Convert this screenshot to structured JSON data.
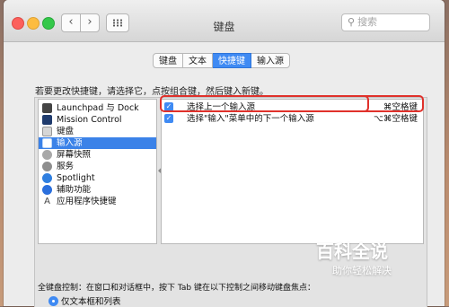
{
  "window": {
    "title": "键盘",
    "search_placeholder": "搜索",
    "nav_back": "‹",
    "nav_forward": "›"
  },
  "tabs": [
    {
      "label": "键盘",
      "active": false
    },
    {
      "label": "文本",
      "active": false
    },
    {
      "label": "快捷键",
      "active": true
    },
    {
      "label": "输入源",
      "active": false
    }
  ],
  "instruction": "若要更改快捷键，请选择它，点按组合键，然后键入新键。",
  "categories": [
    {
      "label": "Launchpad 与 Dock",
      "icon": "launchpad-icon",
      "selected": false
    },
    {
      "label": "Mission Control",
      "icon": "mission-control-icon",
      "selected": false
    },
    {
      "label": "键盘",
      "icon": "keyboard-icon",
      "selected": false
    },
    {
      "label": "输入源",
      "icon": "input-source-icon",
      "selected": true
    },
    {
      "label": "屏幕快照",
      "icon": "screenshot-icon",
      "selected": false
    },
    {
      "label": "服务",
      "icon": "services-icon",
      "selected": false
    },
    {
      "label": "Spotlight",
      "icon": "spotlight-icon",
      "selected": false
    },
    {
      "label": "辅助功能",
      "icon": "accessibility-icon",
      "selected": false
    },
    {
      "label": "应用程序快捷键",
      "icon": "app-shortcuts-icon",
      "selected": false
    }
  ],
  "shortcuts": [
    {
      "checked": true,
      "label": "选择上一个输入源",
      "keys": "⌘空格键"
    },
    {
      "checked": true,
      "label": "选择\"输入\"菜单中的下一个输入源",
      "keys": "⌥⌘空格键"
    }
  ],
  "full_keyboard": {
    "label": "全键盘控制：在窗口和对话框中，按下 Tab 键在以下控制之间移动键盘焦点：",
    "option": "仅文本框和列表"
  },
  "watermark": {
    "top": "百科全说",
    "bottom": "助你轻松解决"
  },
  "colors": {
    "accent": "#3f8af3",
    "selection": "#3b82e8",
    "highlight_border": "#e0312b"
  }
}
